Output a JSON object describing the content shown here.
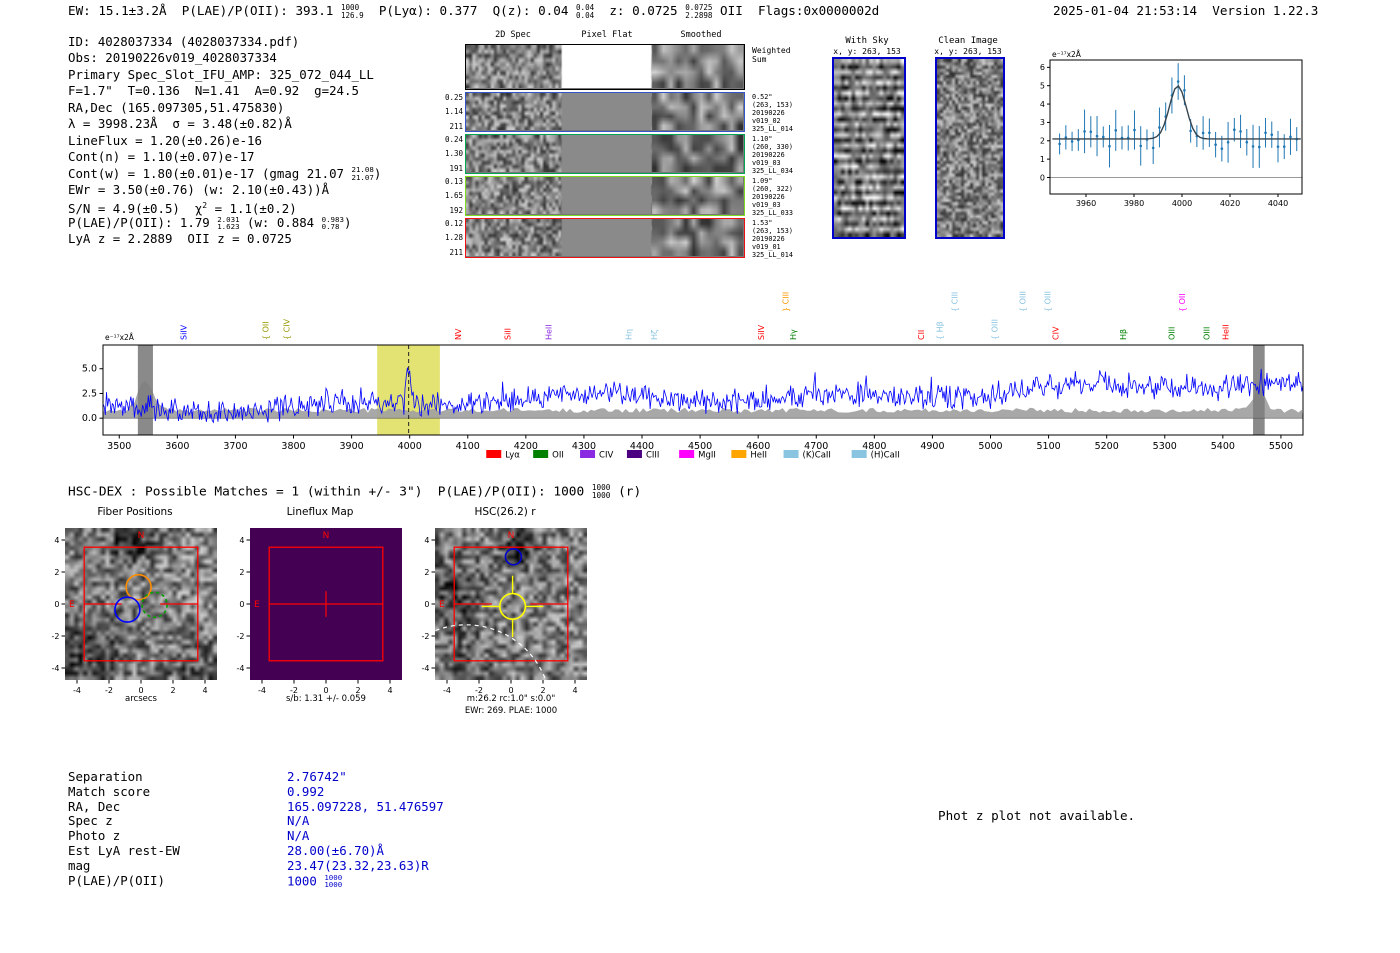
{
  "header": {
    "left_segments": [
      {
        "t": "EW: 15.1±3.2Å  P(LAE)/P(OII): 393.1 "
      },
      {
        "frac": [
          "1000",
          "126.9"
        ]
      },
      {
        "t": "  P(Lyα): 0.377  Q(z): 0.04 "
      },
      {
        "frac": [
          "0.04",
          "0.04"
        ]
      },
      {
        "t": "  z: 0.0725 "
      },
      {
        "frac": [
          "0.0725",
          "2.2898"
        ]
      },
      {
        "t": " OII  Flags:0x0000002d"
      }
    ],
    "datetime": "2025-01-04 21:53:14",
    "version": "Version 1.22.3"
  },
  "info_block": {
    "lines": [
      [
        {
          "t": "ID: 4028037334 (4028037334.pdf)"
        }
      ],
      [
        {
          "t": "Obs: 20190226v019_4028037334"
        }
      ],
      [
        {
          "t": "Primary Spec_Slot_IFU_AMP: 325_072_044_LL"
        }
      ],
      [
        {
          "t": "F=1.7\"  T=0.136  N=1.41  A=0.92  g=24.5"
        }
      ],
      [
        {
          "t": "RA,Dec (165.097305,51.475830)"
        }
      ],
      [
        {
          "t": "λ = 3998.23Å  σ = 3.48(±0.82)Å"
        }
      ],
      [
        {
          "t": "LineFlux = 1.20(±0.26)e-16"
        }
      ],
      [
        {
          "t": "Cont(n) = 1.10(±0.07)e-17"
        }
      ],
      [
        {
          "t": "Cont(w) = 1.80(±0.01)e-17 (gmag 21.07 "
        },
        {
          "frac": [
            "21.08",
            "21.07"
          ]
        },
        {
          "t": ")"
        }
      ],
      [
        {
          "t": "EWr = 3.50(±0.76) (w: 2.10(±0.43))Å"
        }
      ],
      [
        {
          "t": "S/N = 4.9(±0.5)  χ"
        },
        {
          "sup": "2"
        },
        {
          "t": " = 1.1(±0.2)"
        }
      ],
      [
        {
          "t": "P(LAE)/P(OII): 1.79 "
        },
        {
          "frac": [
            "2.031",
            "1.623"
          ]
        },
        {
          "t": " (w: 0.884 "
        },
        {
          "frac": [
            "0.983",
            "0.78"
          ]
        },
        {
          "t": ")"
        }
      ],
      [
        {
          "t": "LyA z = 2.2889  OII z = 0.0725"
        }
      ]
    ]
  },
  "spec2d": {
    "column_titles": [
      "2D Spec",
      "Pixel Flat",
      "Smoothed"
    ],
    "rows": [
      {
        "border": "#000000",
        "stats": [],
        "note": [
          "Weighted",
          "Sum"
        ]
      },
      {
        "border": "#3355cc",
        "stats": [
          "0.25",
          "1.14",
          "211"
        ],
        "note": [
          "0.52\"",
          "(263, 153)",
          "20190226",
          "v019_02",
          "325_LL_014"
        ]
      },
      {
        "border": "#00a651",
        "stats": [
          "0.24",
          "1.30",
          "191"
        ],
        "note": [
          "1.10\"",
          "(260, 330)",
          "20190226",
          "v019_03",
          "325_LL_034"
        ]
      },
      {
        "border": "#7ddc1f",
        "stats": [
          "0.13",
          "1.65",
          "192"
        ],
        "note": [
          "1.09\"",
          "(260, 322)",
          "20190226",
          "v019_03",
          "325_LL_033"
        ]
      },
      {
        "border": "#ee1111",
        "stats": [
          "0.12",
          "1.28",
          "211"
        ],
        "note": [
          "1.53\"",
          "(263, 153)",
          "20190226",
          "v019_01",
          "325_LL_014"
        ]
      }
    ]
  },
  "sky_panels": [
    {
      "title": "With Sky",
      "coords": "x, y: 263, 153",
      "border": "#0000cc"
    },
    {
      "title": "Clean Image",
      "coords": "x, y: 263, 153",
      "border": "#0000cc"
    }
  ],
  "hsc_line_segments": [
    {
      "t": "HSC-DEX : Possible Matches = 1 (within +/- 3\")  P(LAE)/P(OII): 1000 "
    },
    {
      "frac": [
        "1000",
        "1000"
      ]
    },
    {
      "t": " (r)"
    }
  ],
  "match_table": {
    "value_color": "#0000cd",
    "rows": [
      {
        "label": "Separation",
        "value_segments": [
          {
            "t": "2.76742\""
          }
        ]
      },
      {
        "label": "Match score",
        "value_segments": [
          {
            "t": "0.992"
          }
        ]
      },
      {
        "label": "RA, Dec",
        "value_segments": [
          {
            "t": "165.097228, 51.476597"
          }
        ]
      },
      {
        "label": "Spec z",
        "value_segments": [
          {
            "t": "N/A"
          }
        ]
      },
      {
        "label": "Photo z",
        "value_segments": [
          {
            "t": "N/A"
          }
        ]
      },
      {
        "label": "Est LyA rest-EW",
        "value_segments": [
          {
            "t": "28.00(±6.70)Å"
          }
        ]
      },
      {
        "label": "mag",
        "value_segments": [
          {
            "t": "23.47(23.32,23.63)R"
          }
        ]
      },
      {
        "label": "P(LAE)/P(OII)",
        "value_segments": [
          {
            "t": "1000 "
          },
          {
            "frac": [
              "1000",
              "1000"
            ]
          }
        ]
      }
    ]
  },
  "photz_note": "Phot z plot not available.",
  "chart_data": [
    {
      "id": "line_fit_zoom",
      "type": "line",
      "ylabel": "e⁻¹⁷x2Å",
      "xlim": [
        3945,
        4050
      ],
      "ylim": [
        -0.9,
        6.4
      ],
      "x_ticks": [
        3960,
        3980,
        4000,
        4020,
        4040
      ],
      "y_ticks": [
        0,
        1,
        2,
        3,
        4,
        5,
        6
      ],
      "series": [
        {
          "name": "spectrum_data",
          "style": "errorbar",
          "color": "#1f77b4",
          "baseline": 2.1,
          "noise": 0.55,
          "err": 0.85
        },
        {
          "name": "gaussian_fit",
          "style": "line",
          "color": "#36454f",
          "center": 3998.23,
          "sigma": 3.48,
          "amplitude": 2.9,
          "baseline": 2.1
        }
      ]
    },
    {
      "id": "full_spectrum",
      "type": "line",
      "ylabel": "e⁻¹⁷x2Å",
      "xlim": [
        3472,
        5538
      ],
      "ylim": [
        -1.7,
        7.4
      ],
      "x_ticks": [
        3500,
        3600,
        3700,
        3800,
        3900,
        4000,
        4100,
        4200,
        4300,
        4400,
        4500,
        4600,
        4700,
        4800,
        4900,
        5000,
        5100,
        5200,
        5300,
        5400,
        5500
      ],
      "y_ticks": [
        0.0,
        2.5,
        5.0
      ],
      "line_color": "#0000ff",
      "noise_band_color": "#9e9e9e",
      "masked_band_color": "#7d7d7d",
      "highlight": {
        "x0": 3944,
        "x1": 4052,
        "color": "#cccc00",
        "line": 3998.23
      },
      "masked_bands": [
        {
          "x0": 3532,
          "x1": 3558
        },
        {
          "x0": 5452,
          "x1": 5472
        }
      ],
      "baseline": {
        "start": 0.95,
        "end": 3.25
      },
      "peak": {
        "center": 3998.23,
        "sigma": 3.5,
        "amplitude": 2.7
      },
      "emission_lines": [
        {
          "label": "SiIV",
          "wave": 3611,
          "color": "#0000ff",
          "tier": 0,
          "brace": ""
        },
        {
          "label": "OII",
          "wave": 3752,
          "color": "#999900",
          "tier": 0,
          "brace": "{"
        },
        {
          "label": "CIV",
          "wave": 3788,
          "color": "#999900",
          "tier": 0,
          "brace": "{"
        },
        {
          "label": "NV",
          "wave": 4083,
          "color": "#ff0000",
          "tier": 0,
          "brace": ""
        },
        {
          "label": "SiII",
          "wave": 4168,
          "color": "#ff0000",
          "tier": 0,
          "brace": ""
        },
        {
          "label": "HeII",
          "wave": 4239,
          "color": "#8a2be2",
          "tier": 0,
          "brace": ""
        },
        {
          "label": "Hη",
          "wave": 4377,
          "color": "#89c4e1",
          "tier": 0,
          "brace": ""
        },
        {
          "label": "Hζ",
          "wave": 4421,
          "color": "#89c4e1",
          "tier": 0,
          "brace": ""
        },
        {
          "label": "SiIV",
          "wave": 4605,
          "color": "#ff0000",
          "tier": 0,
          "brace": ""
        },
        {
          "label": "CIII",
          "wave": 4647,
          "color": "#ff9900",
          "tier": 1,
          "brace": "}"
        },
        {
          "label": "Hγ",
          "wave": 4660,
          "color": "#008000",
          "tier": 0,
          "brace": ""
        },
        {
          "label": "CII",
          "wave": 4880,
          "color": "#ff0000",
          "tier": 0,
          "brace": ""
        },
        {
          "label": "Hβ",
          "wave": 4912,
          "color": "#89c4e1",
          "tier": 0,
          "brace": "{"
        },
        {
          "label": "CIII",
          "wave": 4938,
          "color": "#89c4e1",
          "tier": 1,
          "brace": "{"
        },
        {
          "label": "OIII",
          "wave": 5007,
          "color": "#89c4e1",
          "tier": 0,
          "brace": "{"
        },
        {
          "label": "OIII",
          "wave": 5055,
          "color": "#89c4e1",
          "tier": 1,
          "brace": "{"
        },
        {
          "label": "OIII",
          "wave": 5098,
          "color": "#89c4e1",
          "tier": 1,
          "brace": "{"
        },
        {
          "label": "CIV",
          "wave": 5112,
          "color": "#ff0000",
          "tier": 0,
          "brace": ""
        },
        {
          "label": "Hβ",
          "wave": 5228,
          "color": "#008000",
          "tier": 0,
          "brace": ""
        },
        {
          "label": "OIII",
          "wave": 5312,
          "color": "#008000",
          "tier": 0,
          "brace": ""
        },
        {
          "label": "OII",
          "wave": 5330,
          "color": "#ff00ff",
          "tier": 1,
          "brace": "{"
        },
        {
          "label": "OIII",
          "wave": 5372,
          "color": "#008000",
          "tier": 0,
          "brace": ""
        },
        {
          "label": "HeII",
          "wave": 5405,
          "color": "#ff0000",
          "tier": 0,
          "brace": ""
        }
      ],
      "legend": [
        {
          "label": "Lyα",
          "color": "#ff0000"
        },
        {
          "label": "OII",
          "color": "#008000"
        },
        {
          "label": "CIV",
          "color": "#8a2be2"
        },
        {
          "label": "CIII",
          "color": "#4b0082"
        },
        {
          "label": "MgII",
          "color": "#ff00ff"
        },
        {
          "label": "HeII",
          "color": "#ffa500"
        },
        {
          "label": "(K)CaII",
          "color": "#89c4e1"
        },
        {
          "label": "(H)CaII",
          "color": "#89c4e1"
        }
      ]
    },
    {
      "id": "fiber_positions",
      "type": "image_cutout",
      "title": "Fiber Positions",
      "xlabel": "arcsecs",
      "axis_ticks": [
        -4,
        -2,
        0,
        2,
        4
      ],
      "range": 4.75,
      "compass": [
        "N",
        "E"
      ],
      "square_color": "#ff0000",
      "cross_stubs": true,
      "circles": [
        {
          "cx": -0.15,
          "cy": 1.05,
          "r": 0.78,
          "color": "#ff8c00"
        },
        {
          "cx": -0.85,
          "cy": -0.35,
          "r": 0.78,
          "color": "#0000ff"
        },
        {
          "cx": 0.85,
          "cy": -0.05,
          "r": 0.78,
          "color": "#00a000",
          "dashed": true
        }
      ]
    },
    {
      "id": "lineflux_map",
      "type": "heatmap",
      "title": "Lineflux Map",
      "xlabel": "s/b: 1.31 +/- 0.059",
      "axis_ticks": [
        -4,
        -2,
        0,
        2,
        4
      ],
      "range": 4.75,
      "bg": "#440154",
      "compass": [
        "N",
        "E"
      ],
      "square_color": "#ff0000",
      "cross_full": true
    },
    {
      "id": "hsc_r",
      "type": "image_cutout",
      "title": "HSC(26.2) r",
      "xlabel": "m:26.2 rc:1.0\" s:0.0\"",
      "xlabel2": "EWr: 269. PLAE: 1000",
      "axis_ticks": [
        -4,
        -2,
        0,
        2,
        4
      ],
      "range": 4.75,
      "compass": [
        "N",
        "E"
      ],
      "square_color": "#ff0000",
      "cross_stubs": true,
      "circles": [
        {
          "cx": 0.1,
          "cy": -0.15,
          "r": 0.8,
          "color": "#ffff00",
          "target": true
        },
        {
          "cx": 0.15,
          "cy": 2.95,
          "r": 0.5,
          "color": "#0000cc"
        }
      ],
      "dashed_arc": {
        "cx": -2.8,
        "cy": -6.6,
        "r": 5.3,
        "color": "#ffffff"
      }
    }
  ]
}
